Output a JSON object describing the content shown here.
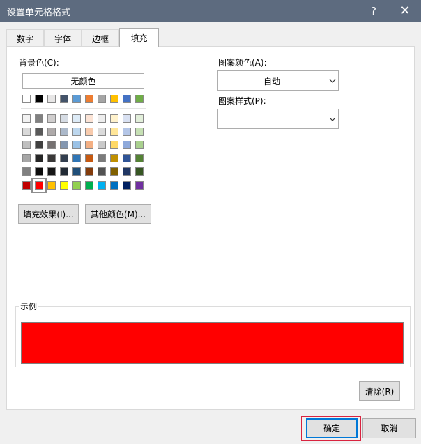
{
  "dialog": {
    "title": "设置单元格格式",
    "help": "?",
    "close": "✕"
  },
  "tabs": [
    "数字",
    "字体",
    "边框",
    "填充"
  ],
  "left": {
    "background_label": "背景色(C):",
    "no_color": "无颜色",
    "fill_effects": "填充效果(I)...",
    "more_colors": "其他颜色(M)..."
  },
  "right": {
    "pattern_color_label": "图案颜色(A):",
    "pattern_color_value": "自动",
    "pattern_style_label": "图案样式(P):",
    "pattern_style_value": ""
  },
  "sample": {
    "label": "示例",
    "color": "#FF0000"
  },
  "buttons": {
    "clear": "清除(R)",
    "ok": "确定",
    "cancel": "取消"
  },
  "palette": {
    "theme_top": [
      "#FFFFFF",
      "#000000",
      "#E7E6E6",
      "#44546A",
      "#5B9BD5",
      "#ED7D31",
      "#A5A5A5",
      "#FFC000",
      "#4472C4",
      "#70AD47"
    ],
    "theme_shades": [
      [
        "#F2F2F2",
        "#808080",
        "#D0CECE",
        "#D6DCE4",
        "#DDEBF7",
        "#FCE4D6",
        "#EDEDED",
        "#FFF2CC",
        "#D9E1F2",
        "#E2EFDA"
      ],
      [
        "#D9D9D9",
        "#595959",
        "#AEAAAA",
        "#ACB9CA",
        "#BDD7EE",
        "#F8CBAD",
        "#DBDBDB",
        "#FFE699",
        "#B4C6E7",
        "#C6E0B4"
      ],
      [
        "#BFBFBF",
        "#404040",
        "#757171",
        "#8497B0",
        "#9BC2E6",
        "#F4B084",
        "#C9C9C9",
        "#FFD966",
        "#8EA9DB",
        "#A9D08E"
      ],
      [
        "#A6A6A6",
        "#262626",
        "#3A3838",
        "#333F4F",
        "#2F75B5",
        "#C65911",
        "#7B7B7B",
        "#BF8F00",
        "#305496",
        "#548235"
      ],
      [
        "#808080",
        "#0D0D0D",
        "#161616",
        "#222B35",
        "#1F4E78",
        "#833C0C",
        "#525252",
        "#806000",
        "#203764",
        "#375623"
      ]
    ],
    "standard": [
      "#C00000",
      "#FF0000",
      "#FFC000",
      "#FFFF00",
      "#92D050",
      "#00B050",
      "#00B0F0",
      "#0070C0",
      "#002060",
      "#7030A0"
    ],
    "selected_standard_index": 1
  }
}
